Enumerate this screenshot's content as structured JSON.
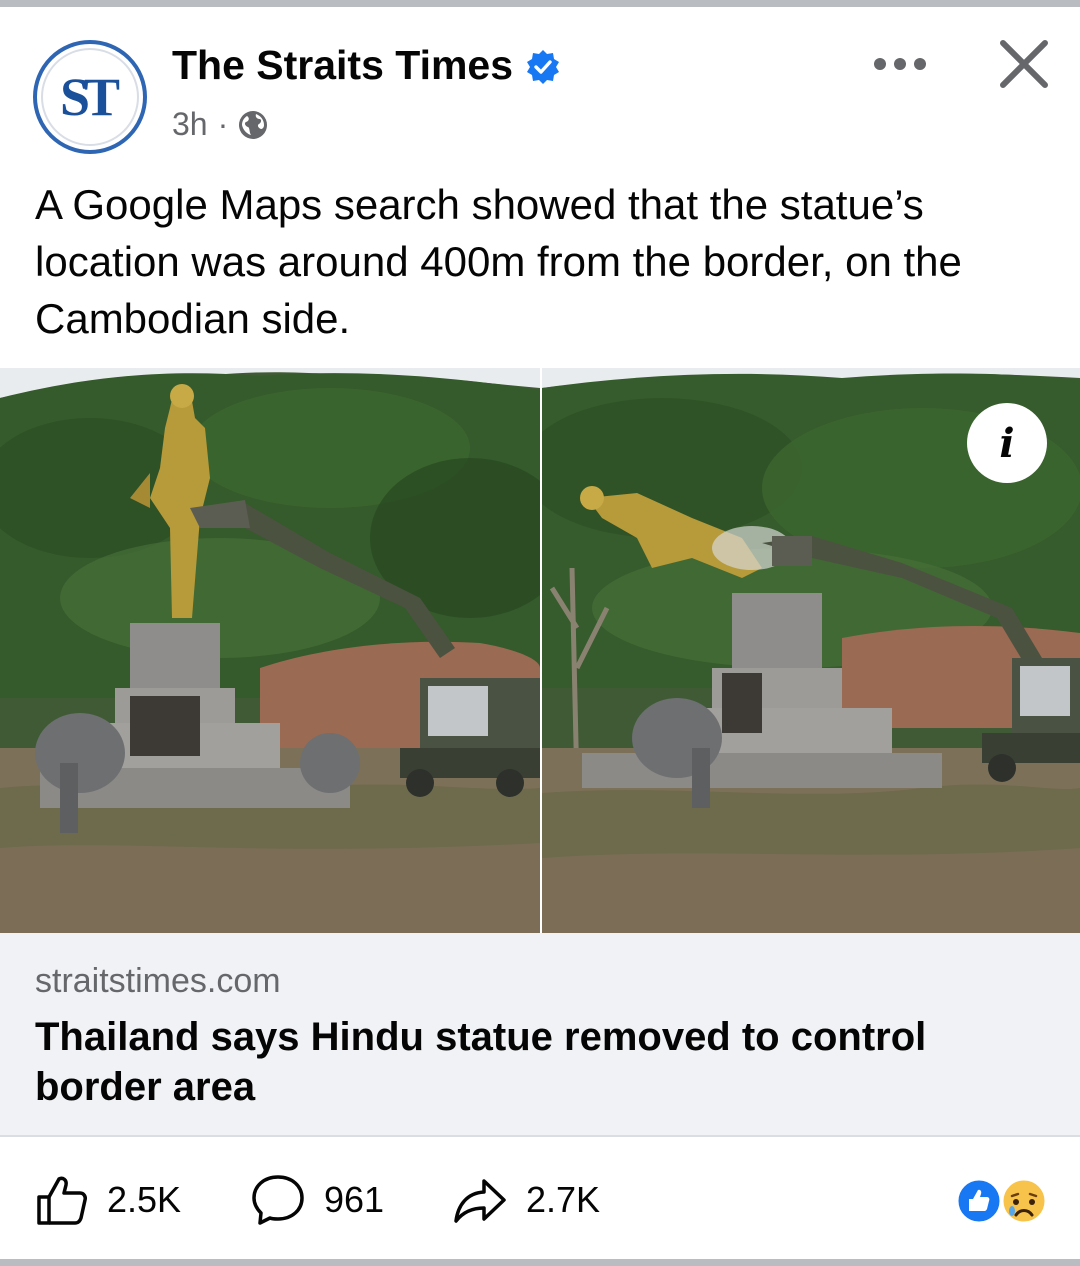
{
  "post": {
    "page_name": "The Straits Times",
    "avatar_initials": "ST",
    "timestamp": "3h",
    "separator": "·",
    "audience_icon": "globe-icon",
    "verified_icon": "verified-badge-icon",
    "text": "A Google Maps search showed that the statue’s location was around 400m from the border, on the Cambodian side."
  },
  "header_actions": {
    "more_icon": "more-options-icon",
    "close_icon": "close-icon"
  },
  "media": {
    "info_label": "i",
    "left_photo": "statue-before-demolition",
    "right_photo": "statue-being-demolished"
  },
  "link_preview": {
    "domain": "straitstimes.com",
    "title": "Thailand says Hindu statue removed to control border area"
  },
  "actions": {
    "likes": "2.5K",
    "comments": "961",
    "shares": "2.7K"
  },
  "reactions": [
    "like",
    "sad"
  ],
  "colors": {
    "brand_blue": "#2f66b3",
    "verified_blue": "#1877f2",
    "secondary_text": "#65676b",
    "card_background": "#f0f2f5"
  }
}
